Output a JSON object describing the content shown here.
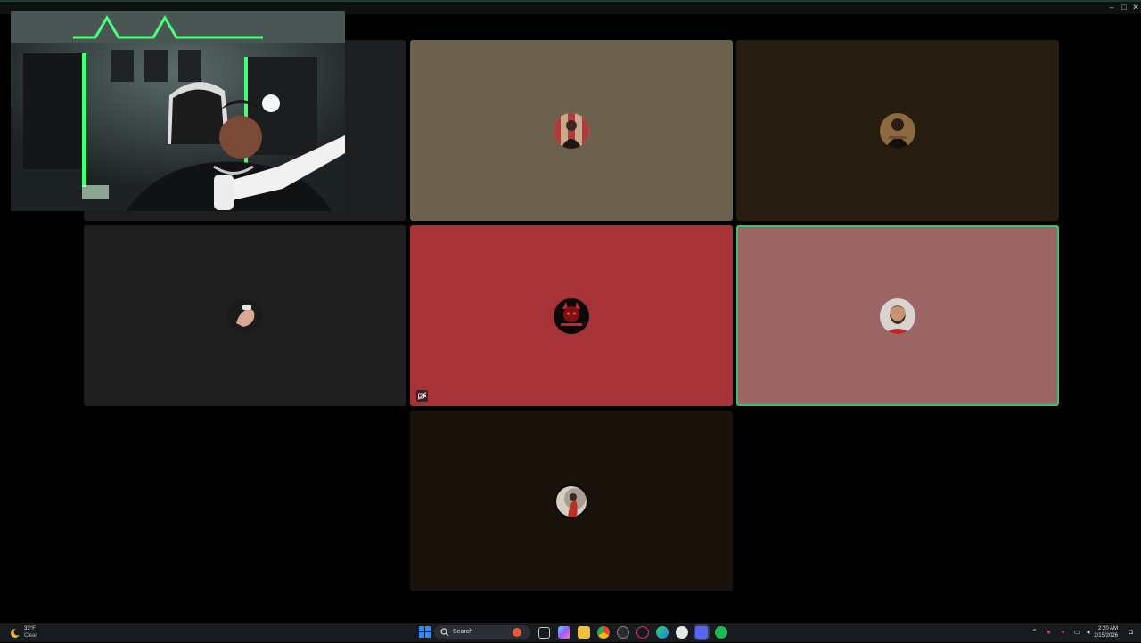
{
  "window": {
    "minimize_glyph": "–",
    "maximize_glyph": "□",
    "close_glyph": "✕"
  },
  "tiles": [
    {
      "id": "tile-participant-1",
      "bg": "#6c604e",
      "avatar": "portrait-striped-bg-avatar"
    },
    {
      "id": "tile-participant-2",
      "bg": "#271c10",
      "avatar": "portrait-dark-avatar"
    },
    {
      "id": "tile-participant-3",
      "bg": "#1f1f20",
      "avatar": "fist-avatar"
    },
    {
      "id": "tile-participant-4",
      "bg": "#a63338",
      "avatar": "red-devil-logo-avatar",
      "camera_off_icon": "camera-off-icon"
    },
    {
      "id": "tile-participant-5",
      "bg": "#9b6465",
      "avatar": "bearded-man-avatar",
      "speaking": true
    },
    {
      "id": "tile-participant-6",
      "bg": "#1a130b",
      "avatar": "moon-figure-avatar"
    }
  ],
  "self_view": {
    "description_icon": "webcam-video-icon"
  },
  "taskbar": {
    "weather": {
      "temp": "33°F",
      "desc": "Clear"
    },
    "search_placeholder": "Search",
    "clock": {
      "time": "2:20 AM",
      "date": "2/15/2026"
    },
    "accent": "#0078d4"
  }
}
